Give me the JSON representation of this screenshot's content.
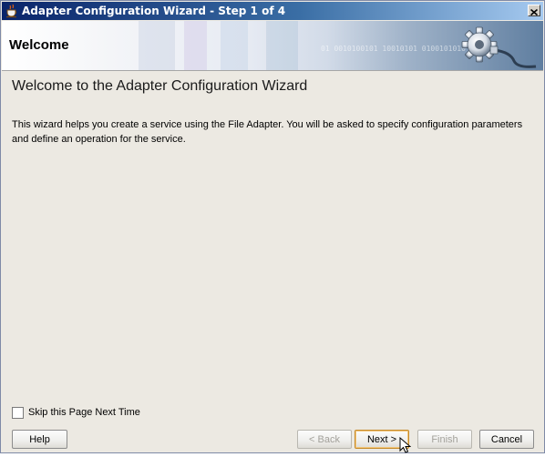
{
  "window": {
    "title": "Adapter Configuration Wizard - Step 1 of 4",
    "title_icon": "java-cup-icon",
    "close_icon": "close-x-icon"
  },
  "banner": {
    "title": "Welcome",
    "binary_text": "01 0010100101 10010101 0100101010",
    "icon": "gear-plug-icon"
  },
  "content": {
    "heading": "Welcome to the Adapter Configuration Wizard",
    "description": "This wizard helps you create a service using the File Adapter. You will be asked to specify configuration parameters and define an operation for the service."
  },
  "options": {
    "skip_label": "Skip this Page Next Time",
    "skip_checked": false
  },
  "buttons": {
    "help": "Help",
    "back": "< Back",
    "next": "Next >",
    "finish": "Finish",
    "cancel": "Cancel"
  },
  "colors": {
    "titlebar_start": "#0a246a",
    "dialog_bg": "#ece9e2",
    "default_button_border": "#c58a2a"
  }
}
